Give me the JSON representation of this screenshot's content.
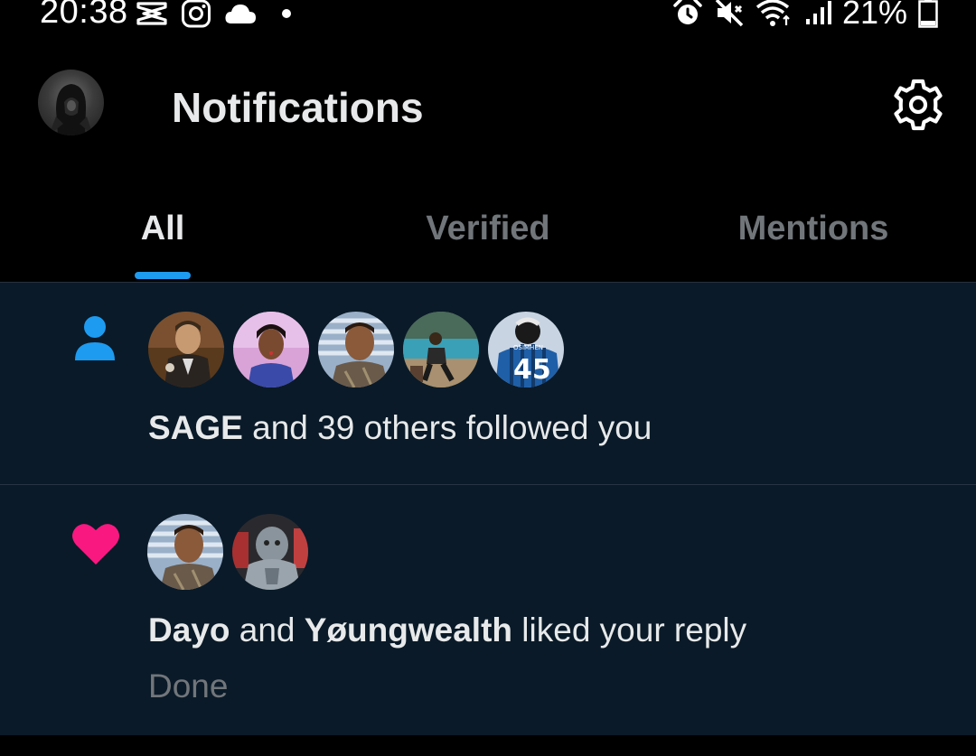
{
  "status_bar": {
    "time": "20:38",
    "battery": "21%",
    "left_icons": [
      "capcut-icon",
      "instagram-icon",
      "cloud-icon",
      "dot-icon"
    ],
    "right_icons": [
      "alarm-icon",
      "mute-icon",
      "wifi-icon",
      "signal-icon",
      "battery-icon"
    ]
  },
  "header": {
    "title": "Notifications",
    "settings_icon": "gear-icon"
  },
  "tabs": [
    {
      "label": "All",
      "active": true
    },
    {
      "label": "Verified",
      "active": false
    },
    {
      "label": "Mentions",
      "active": false
    }
  ],
  "notifications": [
    {
      "type": "follow",
      "type_icon": "person-icon",
      "actor": "SAGE",
      "text": " and 39 others followed you",
      "avatar_count": 5,
      "jersey_number": "45"
    },
    {
      "type": "like",
      "type_icon": "heart-icon",
      "actor1": "Dayo",
      "joiner": " and ",
      "actor2": "Yøungwealth",
      "text": " liked your reply",
      "preview": "Done",
      "avatar_count": 2
    }
  ],
  "colors": {
    "accent": "#1d9bf0",
    "like": "#f91880",
    "background": "#000000",
    "feed_background": "#0a1a28",
    "muted_text": "#71767b"
  }
}
